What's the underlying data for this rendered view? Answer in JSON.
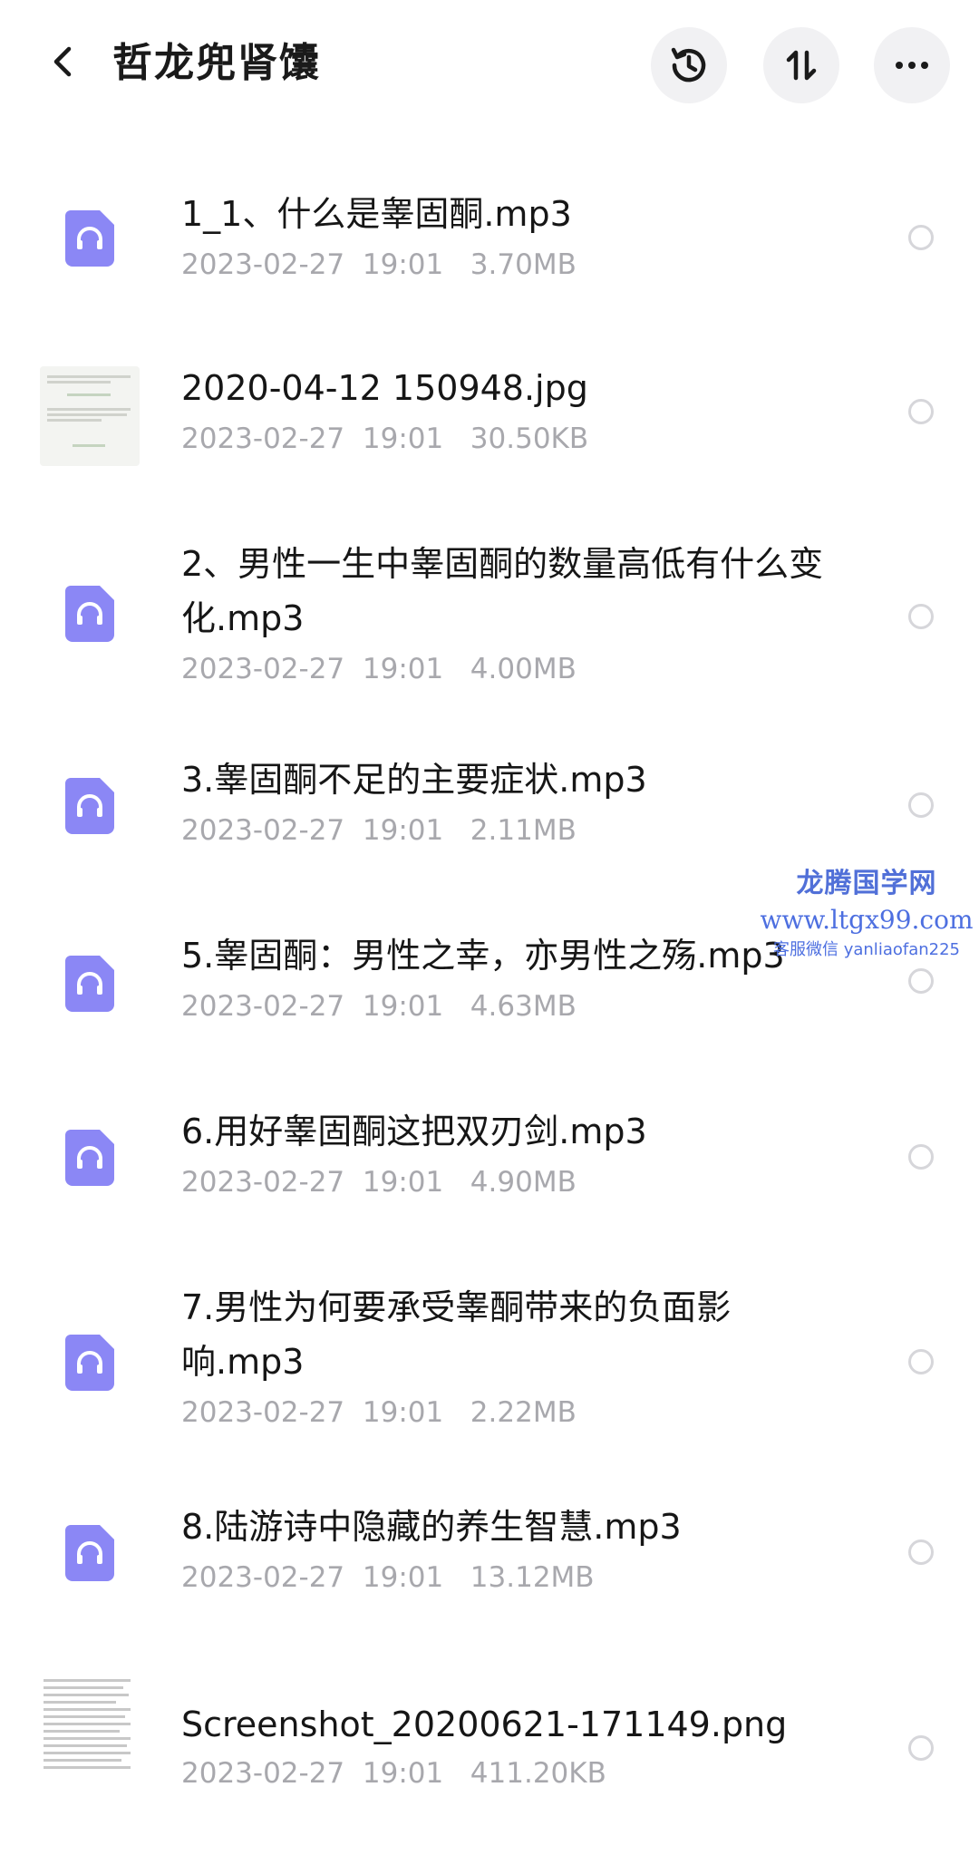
{
  "header": {
    "title": "哲龙兜肾馕",
    "back_icon": "chevron-left-icon",
    "buttons": [
      {
        "icon": "history-icon"
      },
      {
        "icon": "sort-icon"
      },
      {
        "icon": "more-icon"
      }
    ]
  },
  "files": [
    {
      "name": "1_1、什么是睾固酮.mp3",
      "date": "2023-02-27",
      "time": "19:01",
      "size": "3.70MB",
      "type": "audio"
    },
    {
      "name": "2020-04-12 150948.jpg",
      "date": "2023-02-27",
      "time": "19:01",
      "size": "30.50KB",
      "type": "image"
    },
    {
      "name": "2、男性一生中睾固酮的数量高低有什么变化.mp3",
      "date": "2023-02-27",
      "time": "19:01",
      "size": "4.00MB",
      "type": "audio"
    },
    {
      "name": "3.睾固酮不足的主要症状.mp3",
      "date": "2023-02-27",
      "time": "19:01",
      "size": "2.11MB",
      "type": "audio"
    },
    {
      "name": "5.睾固酮：男性之幸，亦男性之殇.mp3",
      "date": "2023-02-27",
      "time": "19:01",
      "size": "4.63MB",
      "type": "audio"
    },
    {
      "name": "6.用好睾固酮这把双刃剑.mp3",
      "date": "2023-02-27",
      "time": "19:01",
      "size": "4.90MB",
      "type": "audio"
    },
    {
      "name": "7.男性为何要承受睾酮带来的负面影响.mp3",
      "date": "2023-02-27",
      "time": "19:01",
      "size": "2.22MB",
      "type": "audio"
    },
    {
      "name": "8.陆游诗中隐藏的养生智慧.mp3",
      "date": "2023-02-27",
      "time": "19:01",
      "size": "13.12MB",
      "type": "audio"
    },
    {
      "name": "Screenshot_20200621-171149.png",
      "date": "2023-02-27",
      "time": "19:01",
      "size": "411.20KB",
      "type": "image"
    }
  ],
  "watermark": {
    "line1": "龙腾国学网",
    "line2": "www.ltgx99.com",
    "line3": "客服微信 yanliaofan225"
  },
  "colors": {
    "audio_icon": "#8b87f5",
    "meta_text": "#a8a8ad",
    "watermark": "#4d6fe0"
  }
}
